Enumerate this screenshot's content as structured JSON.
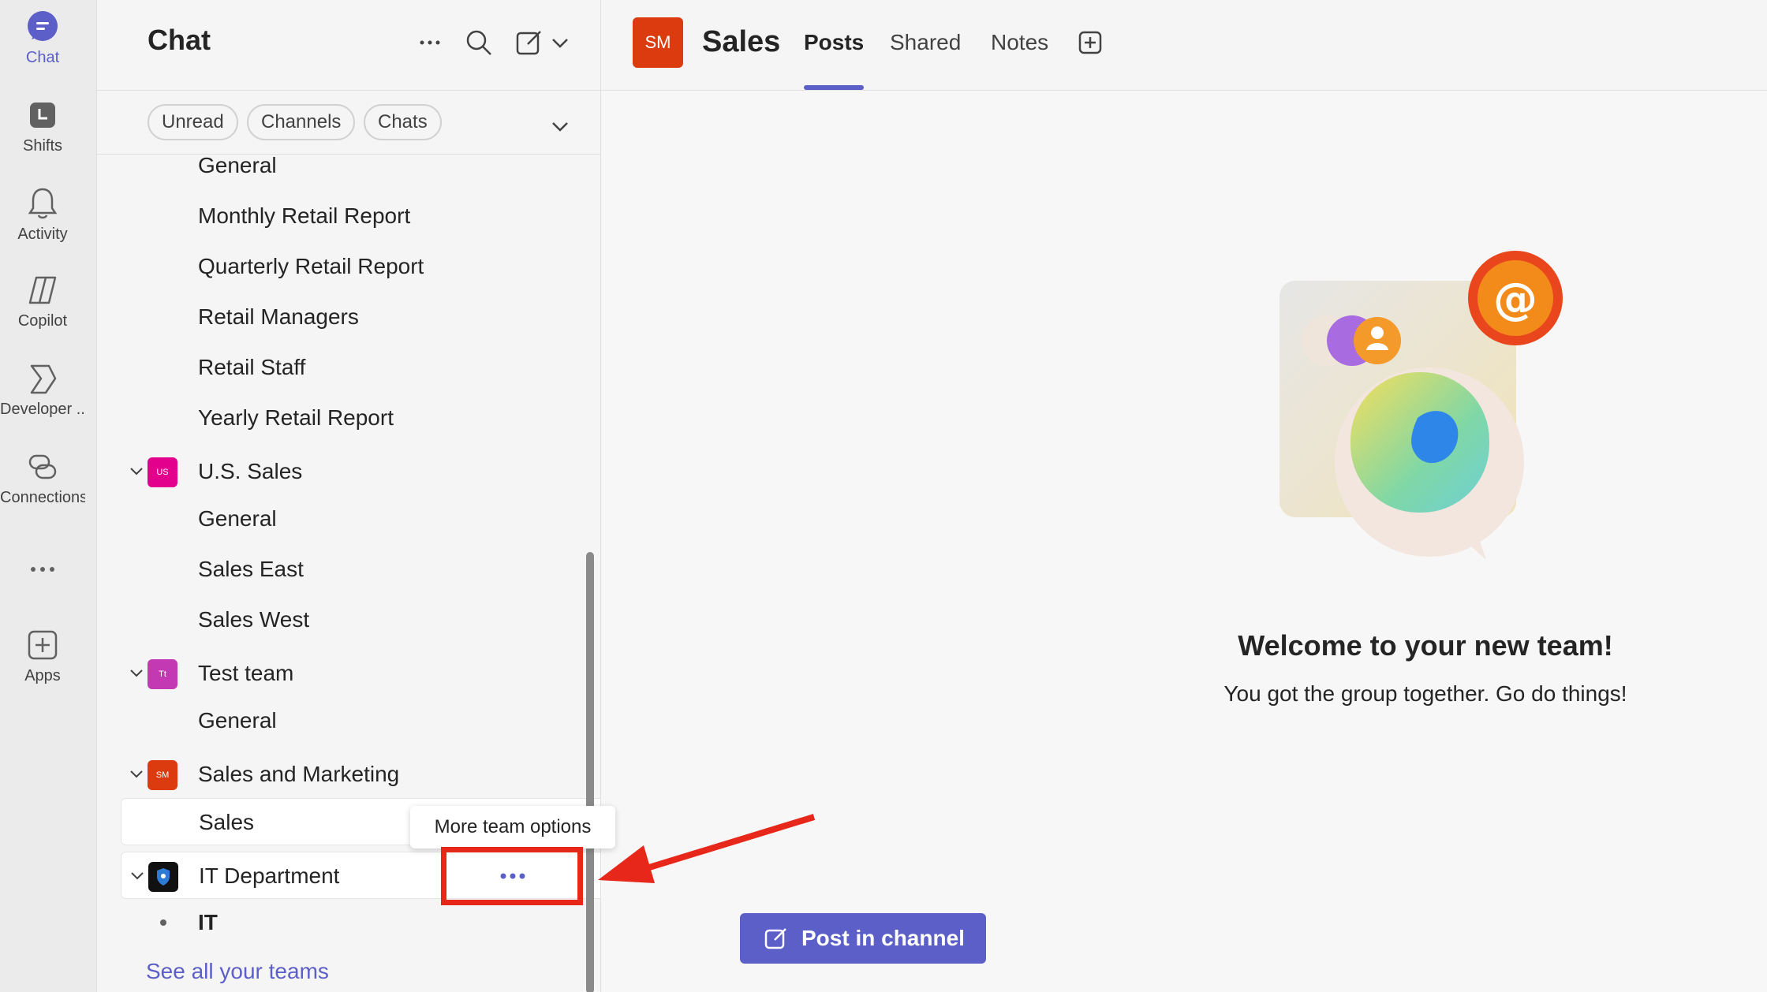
{
  "rail": {
    "items": [
      {
        "label": "Chat",
        "icon": "chat-icon"
      },
      {
        "label": "Shifts",
        "icon": "shifts-icon"
      },
      {
        "label": "Activity",
        "icon": "bell-icon"
      },
      {
        "label": "Copilot",
        "icon": "copilot-icon"
      },
      {
        "label": "Developer ...",
        "icon": "developer-icon"
      },
      {
        "label": "Connections",
        "icon": "connections-icon"
      },
      {
        "label": "",
        "icon": "more-icon"
      },
      {
        "label": "Apps",
        "icon": "apps-icon"
      }
    ]
  },
  "pane": {
    "title": "Chat",
    "filters": [
      "Unread",
      "Channels",
      "Chats"
    ]
  },
  "list": {
    "channels_top": [
      "General",
      "Monthly Retail Report",
      "Quarterly Retail Report",
      "Retail Managers",
      "Retail Staff",
      "Yearly Retail Report"
    ],
    "teams": [
      {
        "name": "U.S. Sales",
        "initials": "US",
        "color": "#e3008c",
        "channels": [
          "General",
          "Sales East",
          "Sales West"
        ]
      },
      {
        "name": "Test team",
        "initials": "Tt",
        "color": "#c239b3",
        "channels": [
          "General"
        ]
      },
      {
        "name": "Sales and Marketing",
        "initials": "SM",
        "color": "#dc3b0f",
        "channels": [
          "Sales"
        ]
      },
      {
        "name": "IT Department",
        "initials": "",
        "color": "#111111",
        "channels": [
          "IT"
        ]
      }
    ],
    "see_all": "See all your teams"
  },
  "tooltip": "More team options",
  "main": {
    "avatar_initials": "SM",
    "channel_title": "Sales",
    "tabs": [
      "Posts",
      "Shared",
      "Notes"
    ],
    "welcome_title": "Welcome to your new team!",
    "welcome_sub": "You got the group together. Go do things!",
    "post_button": "Post in channel"
  },
  "colors": {
    "accent": "#5b5fc7",
    "annotation": "#e8271b"
  }
}
